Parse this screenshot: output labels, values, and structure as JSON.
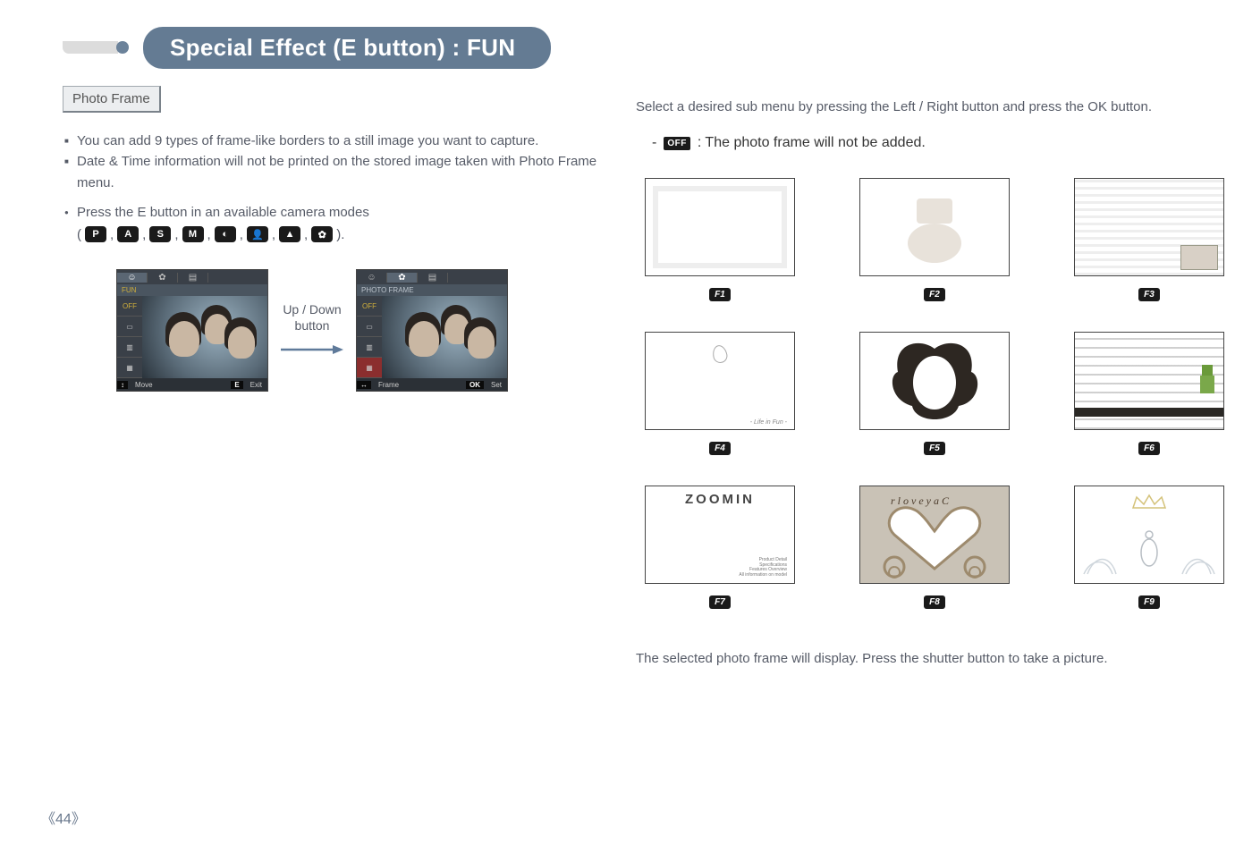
{
  "title": "Special Effect (E button) : FUN",
  "photo_frame": {
    "header": "Photo Frame",
    "bullet_borders": "You can add 9 types of frame-like borders to a still image you want to capture.",
    "bullet_datetime": "Date & Time information will not be printed on the stored image taken with Photo Frame menu.",
    "bullet_press": "Press the E button in an available camera modes"
  },
  "mode_row": {
    "open": "(",
    "close": ").",
    "sep": ","
  },
  "mode_icons": [
    "P",
    "A",
    "S",
    "M",
    "◐",
    "👤",
    "▲",
    "✿"
  ],
  "screen1": {
    "fun_label": "FUN",
    "off_label": "OFF",
    "icon_a": "▭",
    "icon_b": "▥",
    "icon_c": "▦",
    "bar_nav_icon": "↕",
    "bar_move": "Move",
    "bar_e": "E",
    "bar_exit": "Exit"
  },
  "arrow_label_1": "Up / Down",
  "arrow_label_2": "button",
  "screen2": {
    "title": "PHOTO FRAME",
    "off_label": "OFF",
    "icon_a": "▭",
    "icon_b": "▥",
    "icon_c": "▦",
    "bar_nav_icon": "↔",
    "bar_frame": "Frame",
    "bar_ok": "OK",
    "bar_set": "Set"
  },
  "right": {
    "intro": "Select a desired sub menu by pressing the Left / Right button and press the OK button.",
    "off_dash": "-",
    "off_badge": "OFF",
    "off_text": ": The photo frame will not be added.",
    "after_grid": "The selected photo frame will display. Press the shutter button to take a picture."
  },
  "frames": {
    "f1": "F1",
    "f2": "F2",
    "f3": "F3",
    "f4": "F4",
    "f5": "F5",
    "f6": "F6",
    "f7": "F7",
    "f8": "F8",
    "f9": "F9",
    "f7_title": "ZOOMIN",
    "f7_sub": "Product Detail\nSpecifications\nFeatures Overview\nAll information on model"
  },
  "page_number": "44"
}
